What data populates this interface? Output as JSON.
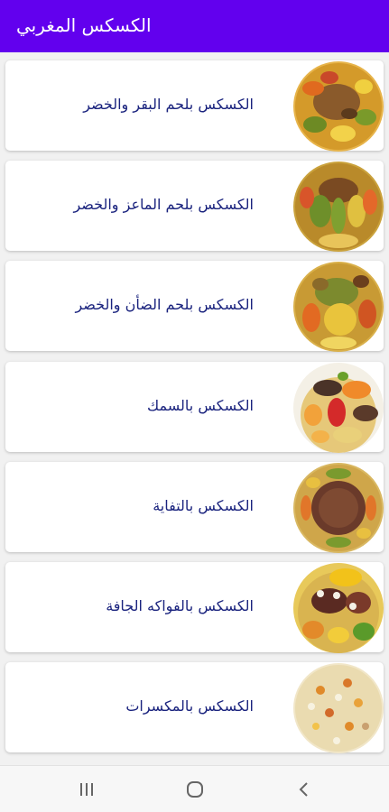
{
  "appbar": {
    "title": "الكسكس المغربي",
    "color": "#6200ee"
  },
  "items": [
    {
      "label": "الكسكس بلحم البقر والخضر",
      "image": "couscous-beef-vegetables-photo"
    },
    {
      "label": "الكسكس بلحم الماعز والخضر",
      "image": "couscous-goat-vegetables-photo"
    },
    {
      "label": "الكسكس بلحم الضأن والخضر",
      "image": "couscous-lamb-vegetables-photo"
    },
    {
      "label": "الكسكس بالسمك",
      "image": "couscous-fish-photo"
    },
    {
      "label": "الكسكس بالتفاية",
      "image": "couscous-tfaya-photo"
    },
    {
      "label": "الكسكس بالفواكه الجافة",
      "image": "couscous-dried-fruits-photo"
    },
    {
      "label": "الكسكس بالمكسرات",
      "image": "couscous-nuts-photo"
    }
  ],
  "navbar": {
    "buttons": [
      "recent-apps-icon",
      "home-icon",
      "back-icon"
    ]
  },
  "colors": {
    "item_text": "#1a237e",
    "background": "#f1f1f1"
  }
}
